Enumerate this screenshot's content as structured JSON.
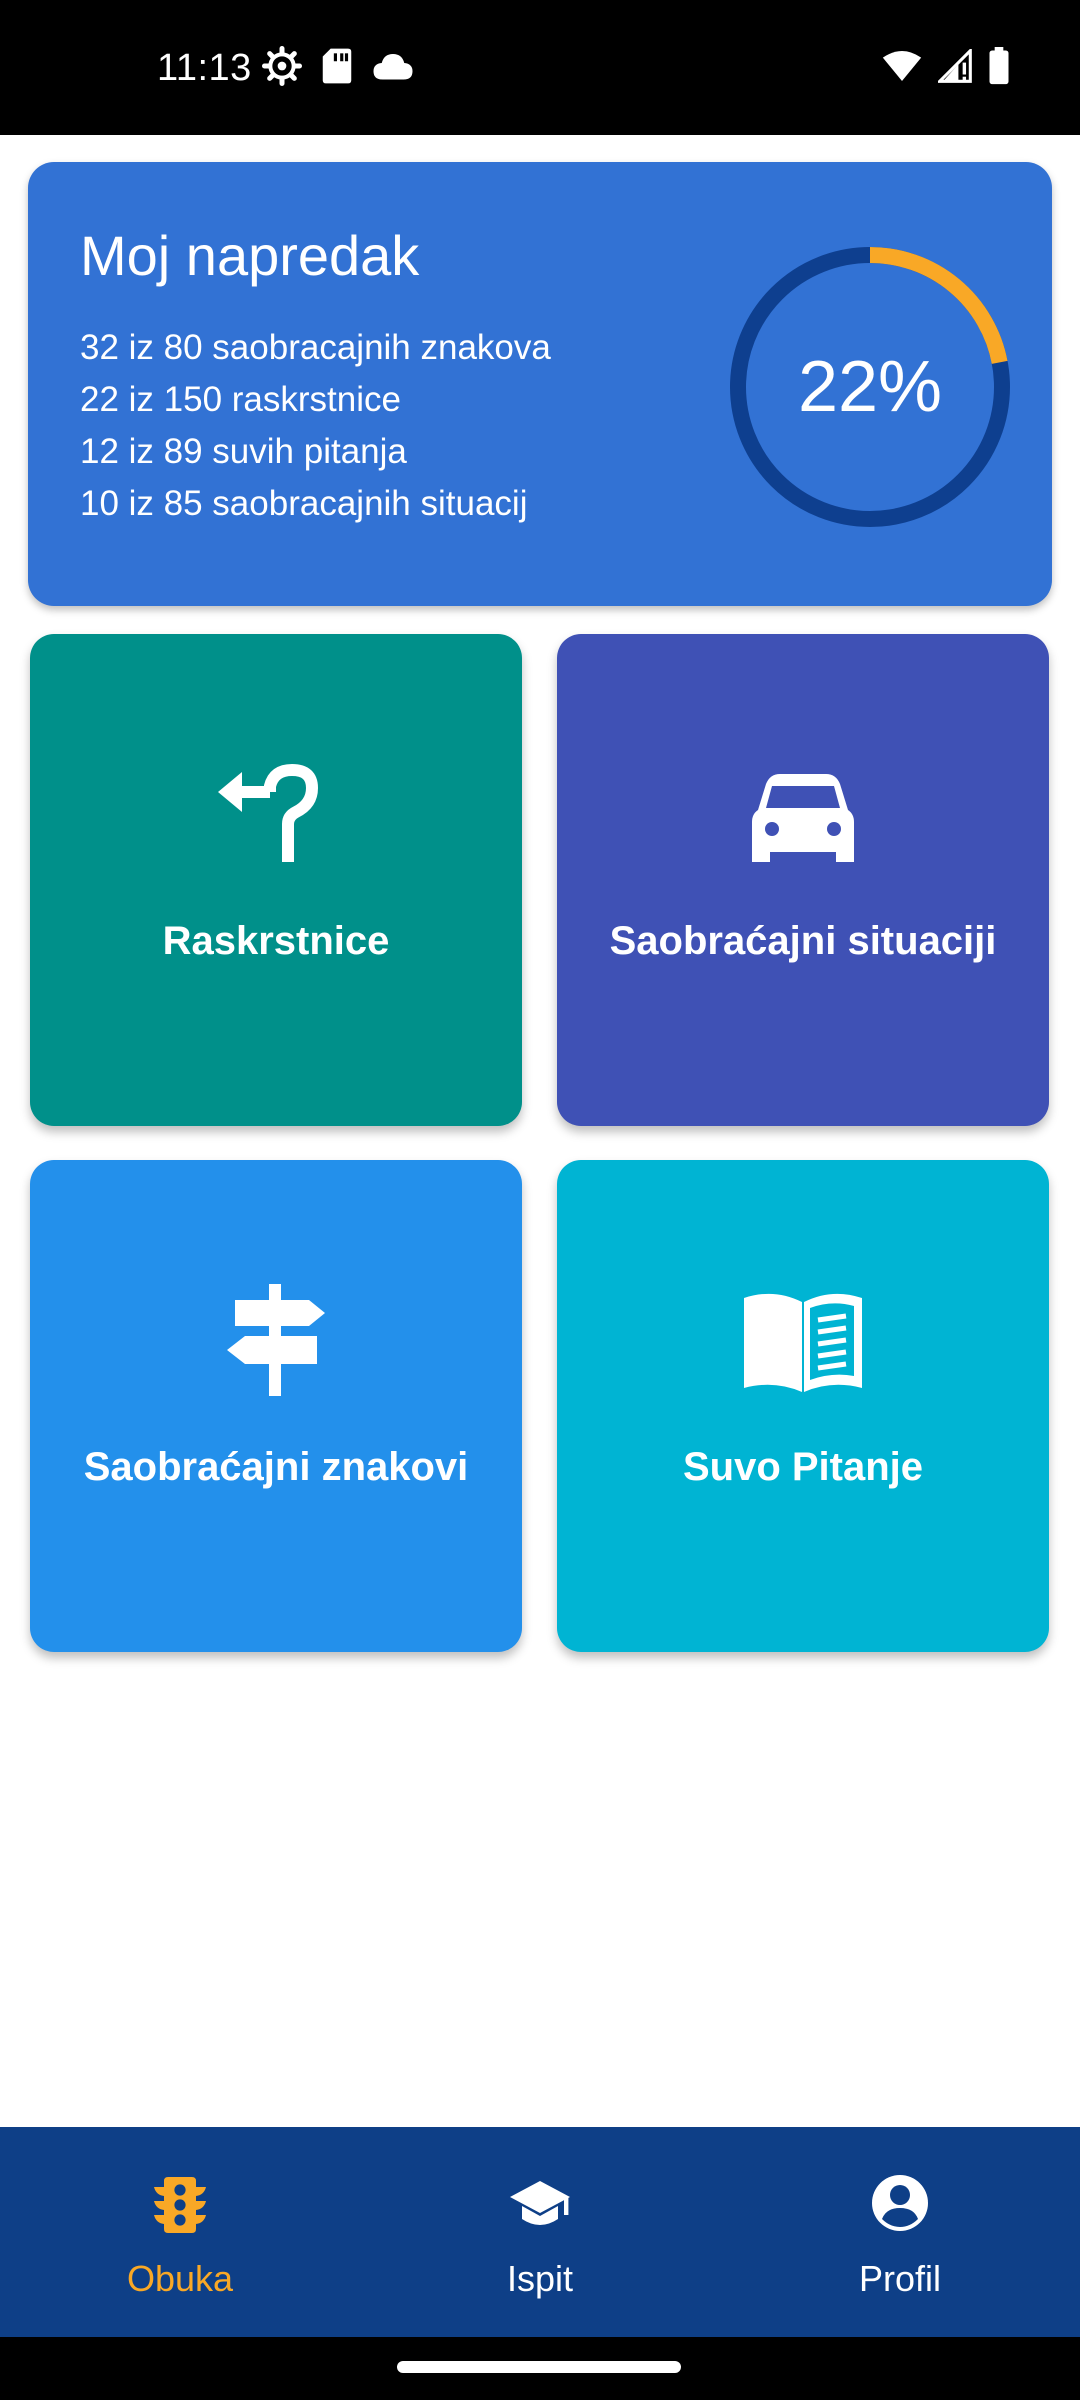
{
  "status_bar": {
    "time": "11:13",
    "left_icons": [
      "settings-gear-icon",
      "sd-card-icon",
      "cloud-icon"
    ],
    "right_icons": [
      "wifi-icon",
      "signal-icon",
      "battery-icon"
    ]
  },
  "progress": {
    "title": "Moj napredak",
    "lines": [
      "32 iz 80 saobracajnih znakova",
      "22 iz 150 raskrstnice",
      "12 iz 89 suvih pitanja",
      "10 iz 85 saobracajnih situacij"
    ],
    "percent_label": "22%",
    "percent_value": 22,
    "colors": {
      "card": "#3272D4",
      "ring_track": "#0E3F8F",
      "ring_fill": "#F9A826"
    }
  },
  "tiles": [
    {
      "label": "Raskrstnice",
      "icon": "u-turn-arrow-icon",
      "color": "#00908A"
    },
    {
      "label": "Saobraćajni situaciji",
      "icon": "car-icon",
      "color": "#3F51B5"
    },
    {
      "label": "Saobraćajni znakovi",
      "icon": "signpost-icon",
      "color": "#2390EB"
    },
    {
      "label": "Suvo Pitanje",
      "icon": "open-book-icon",
      "color": "#00B4D3"
    }
  ],
  "bottom_nav": {
    "background": "#0E3F87",
    "active_color": "#F9A826",
    "inactive_color": "#FFFFFF",
    "items": [
      {
        "label": "Obuka",
        "icon": "traffic-light-icon",
        "active": true
      },
      {
        "label": "Ispit",
        "icon": "graduation-cap-icon",
        "active": false
      },
      {
        "label": "Profil",
        "icon": "account-circle-icon",
        "active": false
      }
    ]
  }
}
